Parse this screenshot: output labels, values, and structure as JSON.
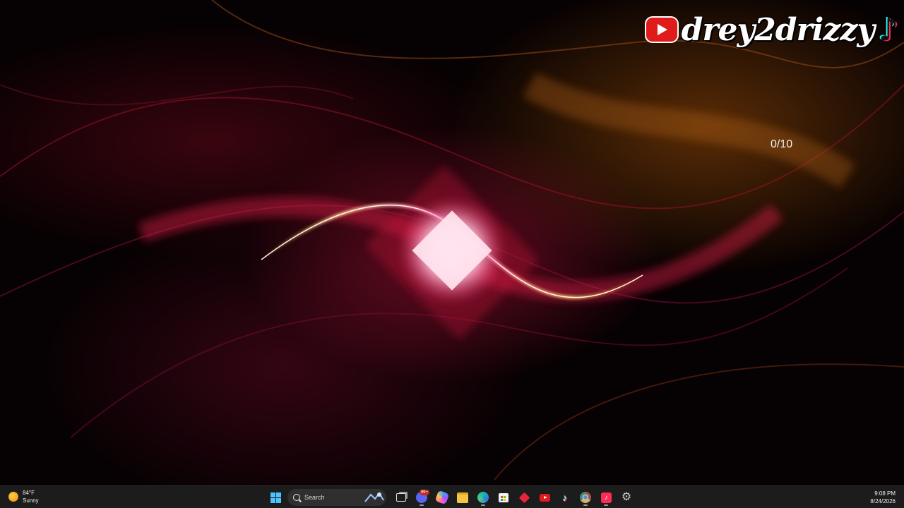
{
  "desktop": {
    "watermark": {
      "text": "drey2drizzy",
      "youtube_icon": "youtube-logo-icon",
      "tiktok_icon": "tiktok-logo-icon"
    },
    "counter": "0/10"
  },
  "taskbar": {
    "weather": {
      "temp": "84°F",
      "condition": "Sunny",
      "icon": "sun-icon"
    },
    "search": {
      "label": "Search"
    },
    "apps": [
      {
        "name": "start",
        "icon": "windows-start-icon"
      },
      {
        "name": "search"
      },
      {
        "name": "task-view",
        "icon": "task-view-icon"
      },
      {
        "name": "discord",
        "icon": "discord-icon",
        "badge": "99+"
      },
      {
        "name": "copilot",
        "icon": "copilot-icon"
      },
      {
        "name": "file-explorer",
        "icon": "folder-icon"
      },
      {
        "name": "edge",
        "icon": "edge-icon"
      },
      {
        "name": "microsoft-store",
        "icon": "store-icon"
      },
      {
        "name": "red-app",
        "icon": "red-diamond-icon"
      },
      {
        "name": "youtube",
        "icon": "youtube-icon"
      },
      {
        "name": "tiktok",
        "icon": "tiktok-icon"
      },
      {
        "name": "chrome",
        "icon": "chrome-icon"
      },
      {
        "name": "tiktok-pink",
        "icon": "tiktok-pink-icon"
      },
      {
        "name": "settings",
        "icon": "gear-icon"
      }
    ],
    "clock": {
      "time": "9:08 PM",
      "date": "8/24/2026"
    }
  },
  "colors": {
    "taskbar_bg": "#1c1c1c",
    "accent_blue": "#4cc2ff",
    "youtube_red": "#e01b1b"
  }
}
